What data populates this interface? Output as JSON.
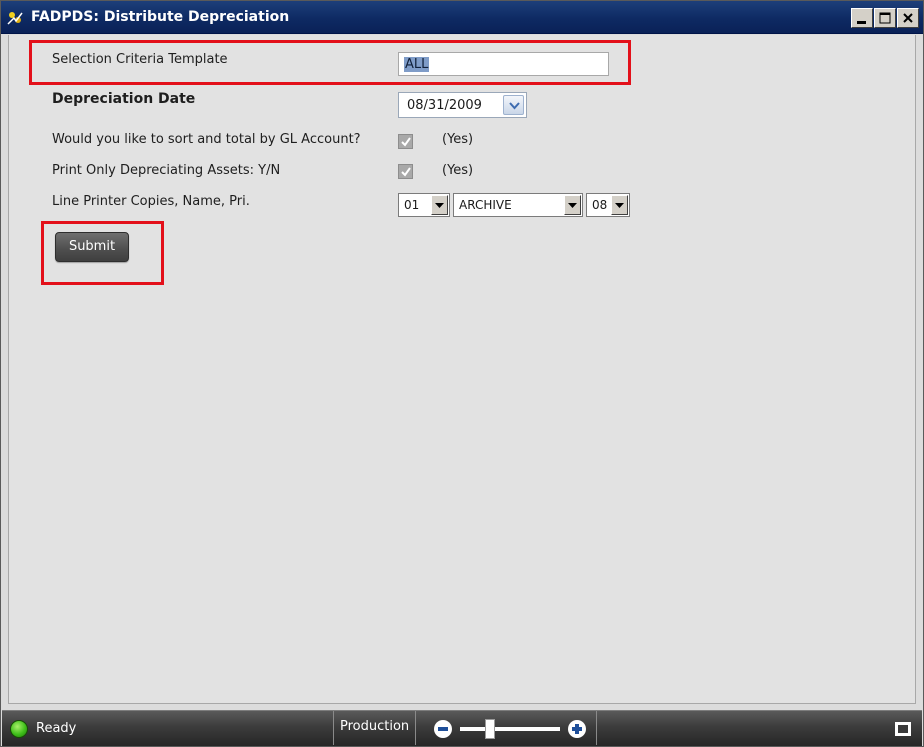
{
  "window": {
    "title": "FADPDS: Distribute Depreciation"
  },
  "form": {
    "selection_template": {
      "label": "Selection Criteria Template",
      "value": "ALL"
    },
    "depreciation_date": {
      "label": "Depreciation Date",
      "value": "08/31/2009"
    },
    "sort_by_gl": {
      "label": "Would you like to sort and total by GL Account?",
      "checked": true,
      "value_text": "(Yes)"
    },
    "print_only_depreciating": {
      "label": "Print Only Depreciating Assets: Y/N",
      "checked": true,
      "value_text": "(Yes)"
    },
    "line_printer": {
      "label": "Line Printer Copies, Name, Pri.",
      "copies": "01",
      "name": "ARCHIVE",
      "priority": "08"
    },
    "submit_label": "Submit"
  },
  "status": {
    "text": "Ready",
    "environment": "Production",
    "indicator_color": "#3fbf1a",
    "zoom_level": 0.3
  },
  "colors": {
    "highlight": "#e3101a",
    "titlebar": "#0e2a63"
  },
  "icons": [
    "app-icon",
    "minimize-icon",
    "maximize-icon",
    "close-icon",
    "dropdown-arrow-icon",
    "checkbox-check-icon",
    "status-ready-icon",
    "zoom-out-icon",
    "zoom-in-icon",
    "fullscreen-icon"
  ]
}
